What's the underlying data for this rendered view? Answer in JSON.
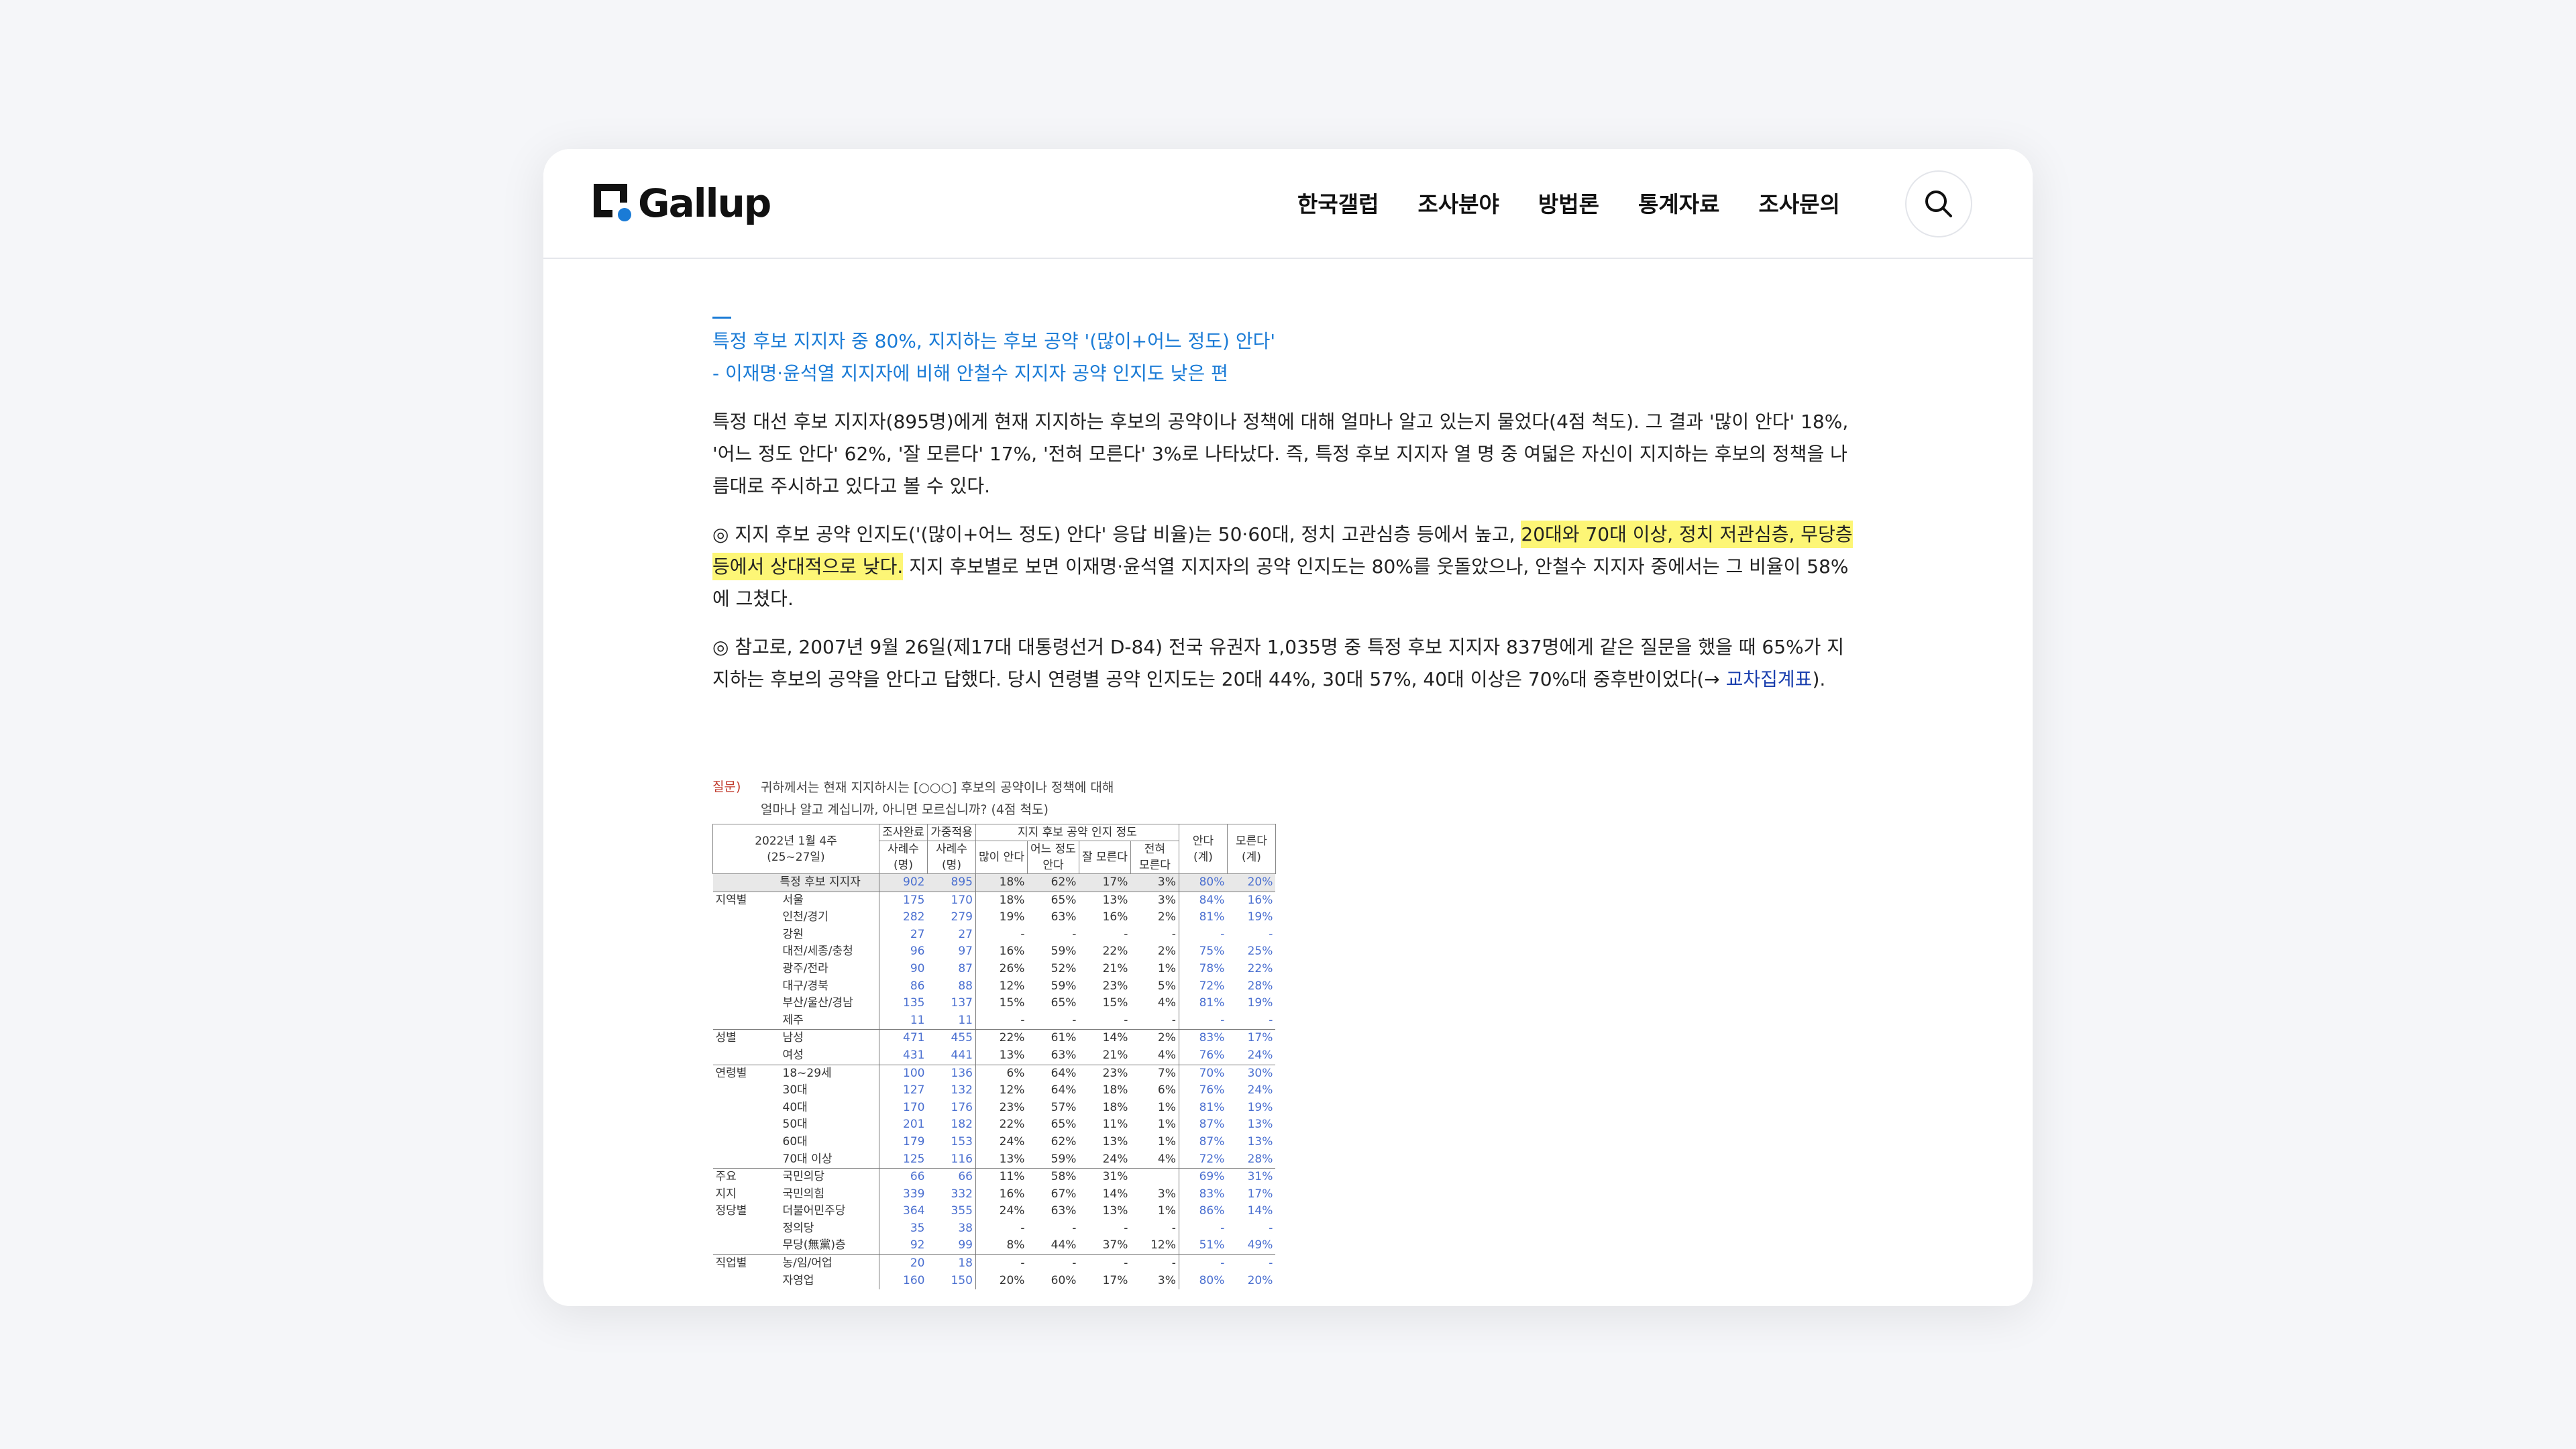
{
  "brand": {
    "name": "Gallup"
  },
  "nav": {
    "items": [
      "한국갤럽",
      "조사분야",
      "방법론",
      "통계자료",
      "조사문의"
    ]
  },
  "article": {
    "subtitle1": "특정 후보 지지자 중 80%, 지지하는 후보 공약 '(많이+어느 정도) 안다'",
    "subtitle2": "- 이재명·윤석열 지지자에 비해 안철수 지지자 공약 인지도 낮은 편",
    "p1": "특정 대선 후보 지지자(895명)에게 현재 지지하는 후보의 공약이나 정책에 대해 얼마나 알고 있는지 물었다(4점 척도). 그 결과 '많이 안다' 18%, '어느 정도 안다' 62%, '잘 모른다' 17%, '전혀 모른다' 3%로 나타났다. 즉, 특정 후보 지지자 열 명 중 여덟은 자신이 지지하는 후보의 정책을 나름대로 주시하고 있다고 볼 수 있다.",
    "p2_start": "◎ 지지 후보 공약 인지도('(많이+어느 정도) 안다' 응답 비율)는 50·60대, 정치 고관심층 등에서 높고, ",
    "p2_highlight": "20대와 70대 이상, 정치 저관심층, 무당층 등에서 상대적으로 낮다.",
    "p2_end": " 지지 후보별로 보면 이재명·윤석열 지지자의 공약 인지도는 80%를 웃돌았으나, 안철수 지지자 중에서는 그 비율이 58%에 그쳤다.",
    "p3_start": "◎ 참고로, 2007년 9월 26일(제17대 대통령선거 D-84) 전국 유권자 1,035명 중 특정 후보 지지자 837명에게 같은 질문을 했을 때 65%가 지지하는 후보의 공약을 안다고 답했다. 당시 연령별 공약 인지도는 20대 44%, 30대 57%, 40대 이상은 70%대 중후반이었다(→ ",
    "p3_link": "교차집계표",
    "p3_end": ")."
  },
  "crosstab": {
    "q_label": "질문)",
    "q_line1": "귀하께서는 현재 지지하시는 [○○○] 후보의 공약이나 정책에 대해",
    "q_line2": "얼마나 알고 계십니까, 아니면 모르십니까? (4점 척도)",
    "h_period1": "2022년 1월 4주",
    "h_period2": "(25~27일)",
    "h_done": "조사완료",
    "h_weight": "가중적용",
    "h_n1": "사례수",
    "h_n2": "(명)",
    "h_group": "지지 후보 공약 인지 정도",
    "h_c1": "많이 안다",
    "h_c2a": "어느 정도",
    "h_c2b": "안다",
    "h_c3": "잘 모른다",
    "h_c4a": "전혀",
    "h_c4b": "모른다",
    "h_k1": "안다",
    "h_k2": "모른다",
    "h_sum": "(계)",
    "rows": [
      {
        "g": "",
        "l": "특정 후보 지지자",
        "v": [
          "902",
          "895",
          "18%",
          "62%",
          "17%",
          "3%",
          "80%",
          "20%"
        ]
      },
      {
        "g": "지역별",
        "l": "서울",
        "v": [
          "175",
          "170",
          "18%",
          "65%",
          "13%",
          "3%",
          "84%",
          "16%"
        ]
      },
      {
        "g": "",
        "l": "인천/경기",
        "v": [
          "282",
          "279",
          "19%",
          "63%",
          "16%",
          "2%",
          "81%",
          "19%"
        ]
      },
      {
        "g": "",
        "l": "강원",
        "v": [
          "27",
          "27",
          "-",
          "-",
          "-",
          "-",
          "-",
          "-"
        ]
      },
      {
        "g": "",
        "l": "대전/세종/충청",
        "v": [
          "96",
          "97",
          "16%",
          "59%",
          "22%",
          "2%",
          "75%",
          "25%"
        ]
      },
      {
        "g": "",
        "l": "광주/전라",
        "v": [
          "90",
          "87",
          "26%",
          "52%",
          "21%",
          "1%",
          "78%",
          "22%"
        ]
      },
      {
        "g": "",
        "l": "대구/경북",
        "v": [
          "86",
          "88",
          "12%",
          "59%",
          "23%",
          "5%",
          "72%",
          "28%"
        ]
      },
      {
        "g": "",
        "l": "부산/울산/경남",
        "v": [
          "135",
          "137",
          "15%",
          "65%",
          "15%",
          "4%",
          "81%",
          "19%"
        ]
      },
      {
        "g": "",
        "l": "제주",
        "v": [
          "11",
          "11",
          "-",
          "-",
          "-",
          "-",
          "-",
          "-"
        ]
      },
      {
        "g": "성별",
        "l": "남성",
        "v": [
          "471",
          "455",
          "22%",
          "61%",
          "14%",
          "2%",
          "83%",
          "17%"
        ]
      },
      {
        "g": "",
        "l": "여성",
        "v": [
          "431",
          "441",
          "13%",
          "63%",
          "21%",
          "4%",
          "76%",
          "24%"
        ]
      },
      {
        "g": "연령별",
        "l": "18~29세",
        "v": [
          "100",
          "136",
          "6%",
          "64%",
          "23%",
          "7%",
          "70%",
          "30%"
        ]
      },
      {
        "g": "",
        "l": "30대",
        "v": [
          "127",
          "132",
          "12%",
          "64%",
          "18%",
          "6%",
          "76%",
          "24%"
        ]
      },
      {
        "g": "",
        "l": "40대",
        "v": [
          "170",
          "176",
          "23%",
          "57%",
          "18%",
          "1%",
          "81%",
          "19%"
        ]
      },
      {
        "g": "",
        "l": "50대",
        "v": [
          "201",
          "182",
          "22%",
          "65%",
          "11%",
          "1%",
          "87%",
          "13%"
        ]
      },
      {
        "g": "",
        "l": "60대",
        "v": [
          "179",
          "153",
          "24%",
          "62%",
          "13%",
          "1%",
          "87%",
          "13%"
        ]
      },
      {
        "g": "",
        "l": "70대 이상",
        "v": [
          "125",
          "116",
          "13%",
          "59%",
          "24%",
          "4%",
          "72%",
          "28%"
        ]
      },
      {
        "g": "주요",
        "l": "국민의당",
        "v": [
          "66",
          "66",
          "11%",
          "58%",
          "31%",
          "",
          "69%",
          "31%"
        ]
      },
      {
        "g": "지지",
        "l": "국민의힘",
        "v": [
          "339",
          "332",
          "16%",
          "67%",
          "14%",
          "3%",
          "83%",
          "17%"
        ]
      },
      {
        "g": "정당별",
        "l": "더불어민주당",
        "v": [
          "364",
          "355",
          "24%",
          "63%",
          "13%",
          "1%",
          "86%",
          "14%"
        ]
      },
      {
        "g": "",
        "l": "정의당",
        "v": [
          "35",
          "38",
          "-",
          "-",
          "-",
          "-",
          "-",
          "-"
        ]
      },
      {
        "g": "",
        "l": "무당(無黨)층",
        "v": [
          "92",
          "99",
          "8%",
          "44%",
          "37%",
          "12%",
          "51%",
          "49%"
        ]
      },
      {
        "g": "직업별",
        "l": "농/임/어업",
        "v": [
          "20",
          "18",
          "-",
          "-",
          "-",
          "-",
          "-",
          "-"
        ]
      },
      {
        "g": "",
        "l": "자영업",
        "v": [
          "160",
          "150",
          "20%",
          "60%",
          "17%",
          "3%",
          "80%",
          "20%"
        ]
      }
    ]
  },
  "colors": {
    "accent": "#1a7bd6",
    "highlight": "#fdf676",
    "link": "#1a3fae"
  }
}
